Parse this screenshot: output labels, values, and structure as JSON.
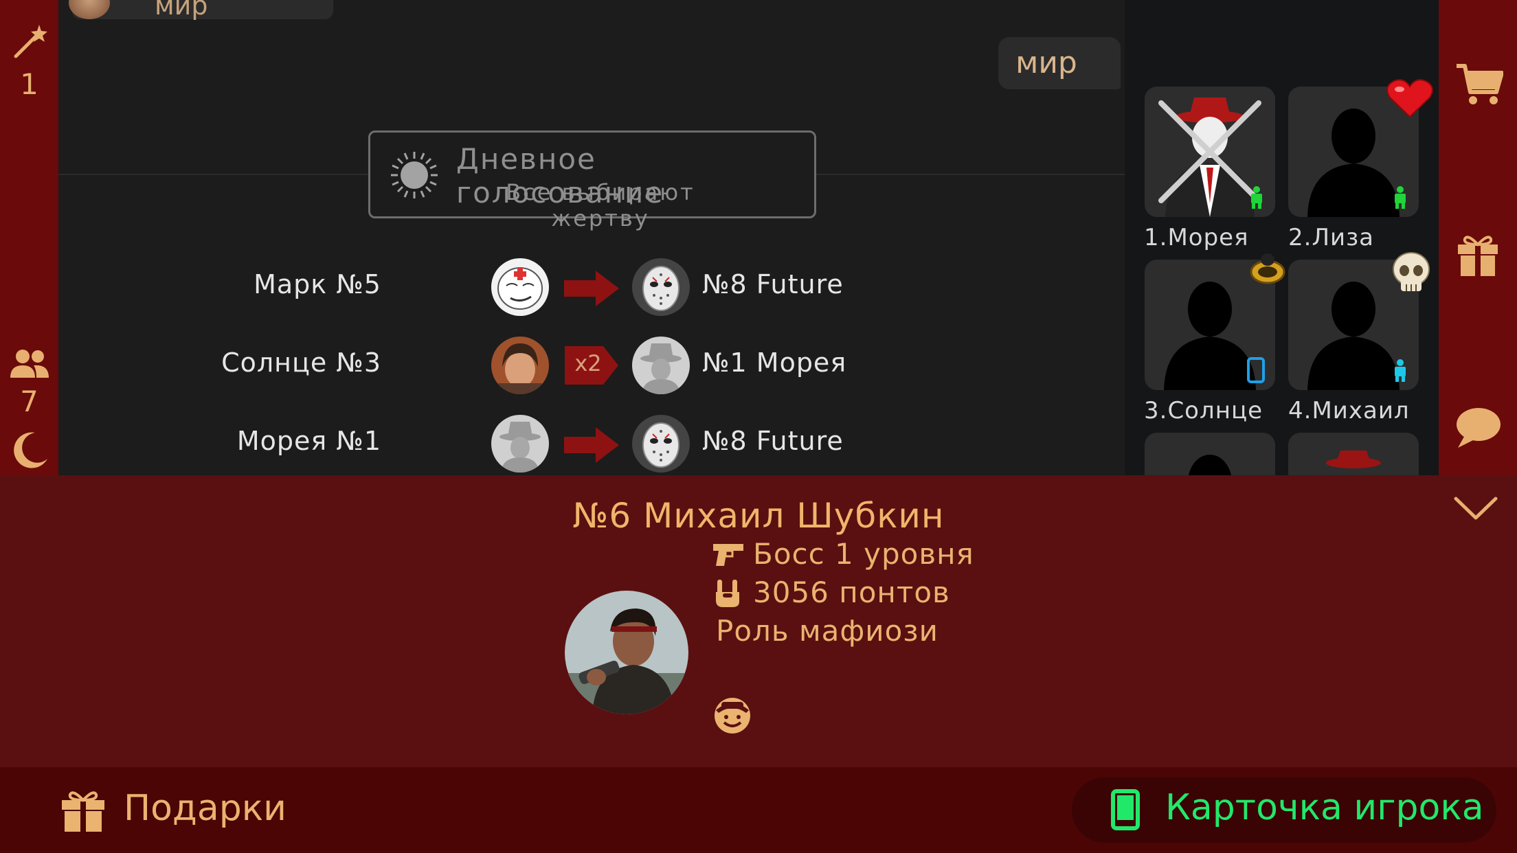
{
  "left_rail": {
    "wand_count": "1",
    "players_count": "7"
  },
  "chat": {
    "prev_message": "мир",
    "my_message": "мир",
    "phase": {
      "title": "Дневное голосование",
      "subtitle": "Все выбирают жертву"
    },
    "votes": [
      {
        "voter": "Марк №5",
        "target": "№8 Future",
        "multiplier": ""
      },
      {
        "voter": "Солнце №3",
        "target": "№1 Морея",
        "multiplier": "x2"
      },
      {
        "voter": "Морея №1",
        "target": "№8 Future",
        "multiplier": ""
      }
    ]
  },
  "players": [
    {
      "label": "1.Морея",
      "status": "dead",
      "device": "android"
    },
    {
      "label": "2.Лиза",
      "status": "alive",
      "device": "android",
      "badge": "heart"
    },
    {
      "label": "3.Солнце",
      "status": "alive",
      "device": "phone",
      "badge": "ring"
    },
    {
      "label": "4.Михаил",
      "status": "alive",
      "device": "android",
      "badge": "skull"
    }
  ],
  "player_sheet": {
    "title": "№6 Михаил Шубкин",
    "rank": "Босс 1 уровня",
    "points": "3056 понтов",
    "role": "Роль мафиози"
  },
  "footer": {
    "gifts_label": "Подарки",
    "card_label": "Карточка игрока"
  },
  "colors": {
    "accent": "#eab370",
    "rail": "#6a0a0a",
    "sheet": "#5a1010",
    "card_text": "#22e86a"
  }
}
